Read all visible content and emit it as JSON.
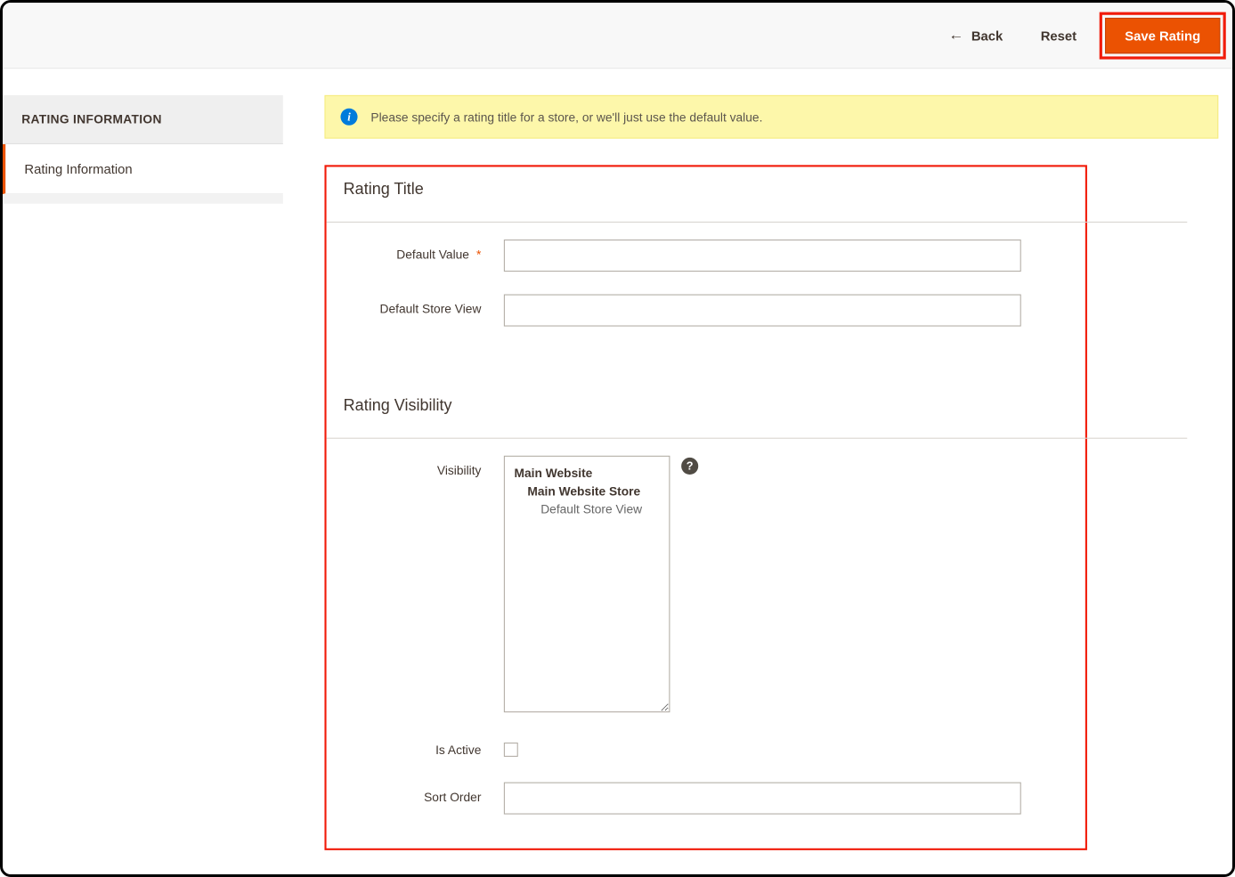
{
  "colors": {
    "accent": "#eb5202",
    "highlight": "#f11b0a",
    "notice_bg": "#fdf7aa"
  },
  "topbar": {
    "back_label": "Back",
    "reset_label": "Reset",
    "save_label": "Save Rating"
  },
  "sidebar": {
    "header": "RATING INFORMATION",
    "items": [
      {
        "label": "Rating Information"
      }
    ]
  },
  "notice": {
    "text": "Please specify a rating title for a store, or we'll just use the default value."
  },
  "sections": {
    "rating_title": {
      "heading": "Rating Title",
      "fields": {
        "default_value": {
          "label": "Default Value",
          "required": true,
          "value": ""
        },
        "default_store_view": {
          "label": "Default Store View",
          "required": false,
          "value": ""
        }
      }
    },
    "rating_visibility": {
      "heading": "Rating Visibility",
      "fields": {
        "visibility": {
          "label": "Visibility",
          "options": [
            {
              "label": "Main Website",
              "level": 0
            },
            {
              "label": "Main Website Store",
              "level": 1
            },
            {
              "label": "Default Store View",
              "level": 2
            }
          ]
        },
        "is_active": {
          "label": "Is Active",
          "checked": false
        },
        "sort_order": {
          "label": "Sort Order",
          "value": ""
        }
      }
    }
  }
}
